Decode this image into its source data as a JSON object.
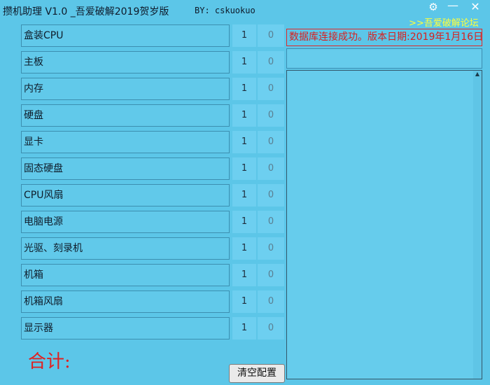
{
  "window": {
    "title": "攒机助理 V1.0 _吾爱破解2019贺岁版",
    "author": "BY: cskuokuo",
    "forum_link": ">>吾爱破解论坛",
    "settings_icon": "gear-icon",
    "minimize_glyph": "—",
    "close_glyph": "✕",
    "gear_glyph": "⚙"
  },
  "components": [
    {
      "label": "盒装CPU",
      "qty": "1",
      "price": "0"
    },
    {
      "label": "主板",
      "qty": "1",
      "price": "0"
    },
    {
      "label": "内存",
      "qty": "1",
      "price": "0"
    },
    {
      "label": "硬盘",
      "qty": "1",
      "price": "0"
    },
    {
      "label": "显卡",
      "qty": "1",
      "price": "0"
    },
    {
      "label": "固态硬盘",
      "qty": "1",
      "price": "0"
    },
    {
      "label": "CPU风扇",
      "qty": "1",
      "price": "0"
    },
    {
      "label": "电脑电源",
      "qty": "1",
      "price": "0"
    },
    {
      "label": "光驱、刻录机",
      "qty": "1",
      "price": "0"
    },
    {
      "label": "机箱",
      "qty": "1",
      "price": "0"
    },
    {
      "label": "机箱风扇",
      "qty": "1",
      "price": "0"
    },
    {
      "label": "显示器",
      "qty": "1",
      "price": "0"
    }
  ],
  "total_label": "合计:",
  "clear_button": "清空配置",
  "status_message": "数据库连接成功。版本日期:2019年1月16日",
  "colors": {
    "background": "#5cc6e8",
    "status_text": "#d82020",
    "forum_link": "#ffff3a"
  }
}
